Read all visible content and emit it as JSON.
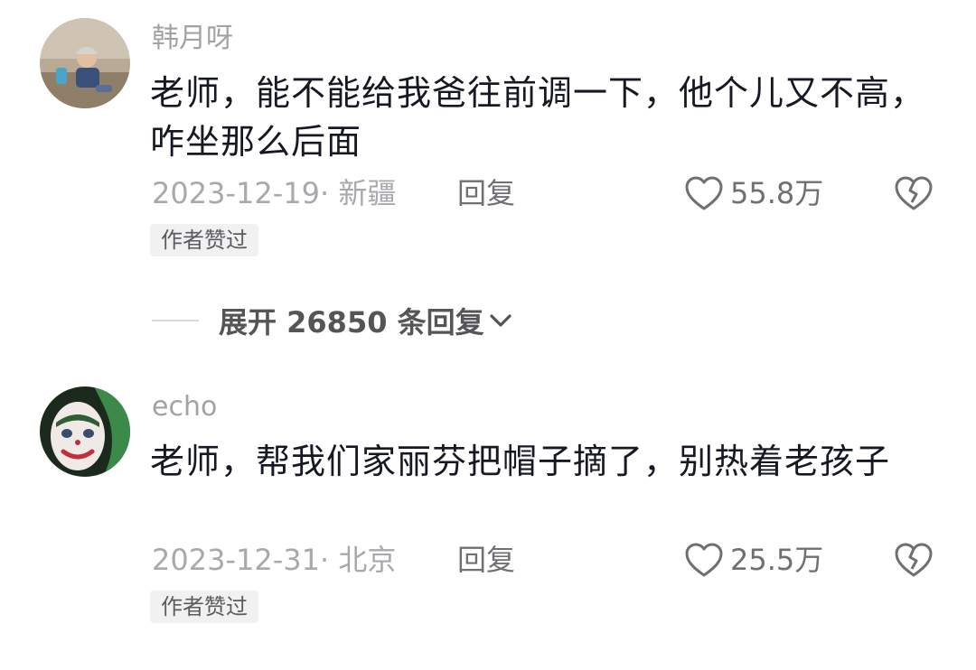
{
  "comments": [
    {
      "username": "韩月呀",
      "text": "老师，能不能给我爸往前调一下，他个儿又不高，咋坐那么后面",
      "date_location": "2023-12-19· 新疆",
      "reply_label": "回复",
      "like_count": "55.8万",
      "author_badge": "作者赞过",
      "avatar_icon": "child-photo-avatar"
    },
    {
      "username": "echo",
      "text": "老师，帮我们家丽芬把帽子摘了，别热着老孩子",
      "date_location": "2023-12-31· 北京",
      "reply_label": "回复",
      "like_count": "25.5万",
      "author_badge": "作者赞过",
      "avatar_icon": "joker-face-avatar"
    }
  ],
  "expand_replies": {
    "label": "展开 26850 条回复",
    "icon": "chevron-down-icon"
  },
  "icons": {
    "like": "heart-outline-icon",
    "dislike": "broken-heart-icon"
  },
  "colors": {
    "text": "#161823",
    "muted": "#a9a9ad",
    "secondary": "#6f6f74",
    "badge_bg": "#f1f1f2"
  }
}
